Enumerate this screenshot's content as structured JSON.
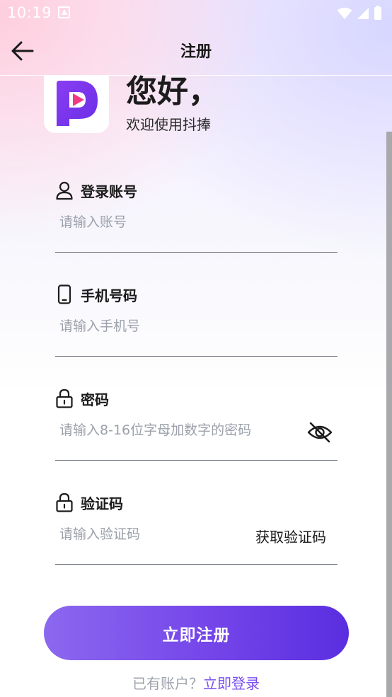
{
  "status_bar": {
    "time": "10:19"
  },
  "app_bar": {
    "title": "注册"
  },
  "greeting": {
    "title": "您好，",
    "subtitle": "欢迎使用抖捧"
  },
  "form": {
    "account": {
      "label": "登录账号",
      "placeholder": "请输入账号",
      "value": ""
    },
    "phone": {
      "label": "手机号码",
      "placeholder": "请输入手机号",
      "value": ""
    },
    "password": {
      "label": "密码",
      "placeholder": "请输入8-16位字母加数字的密码",
      "value": ""
    },
    "code": {
      "label": "验证码",
      "placeholder": "请输入验证码",
      "value": "",
      "get_code_label": "获取验证码"
    }
  },
  "actions": {
    "register_label": "立即注册",
    "login_hint": "已有账户？",
    "login_link": "立即登录"
  },
  "colors": {
    "accent": "#7445e9",
    "logo_purple": "#7a3cf0",
    "logo_pink": "#f23a84",
    "underline": "#6f737c",
    "placeholder": "#9ba0aa"
  },
  "icons": {
    "back": "arrow-left-icon",
    "account": "user-icon",
    "phone": "phone-icon",
    "password": "lock-icon",
    "code": "lock-icon",
    "eye": "eye-off-icon"
  }
}
